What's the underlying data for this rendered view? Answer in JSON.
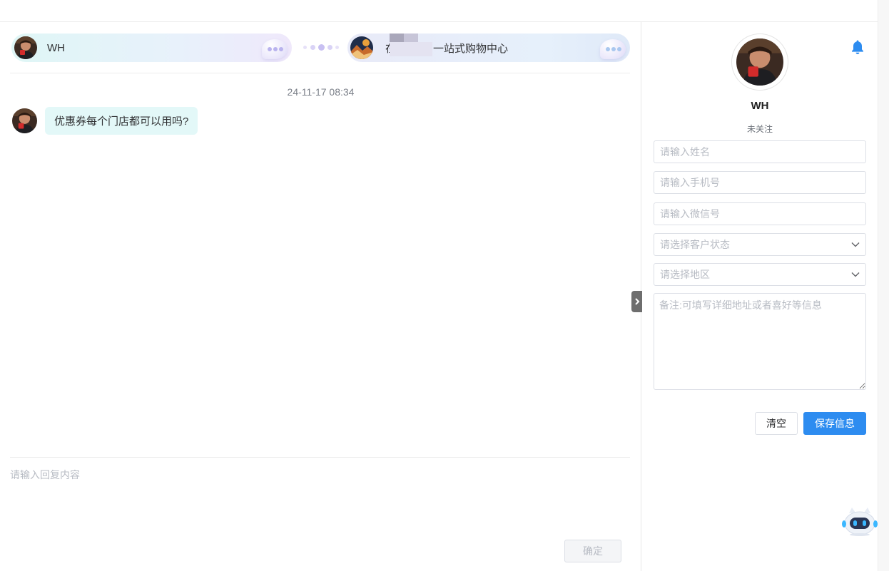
{
  "chat": {
    "user_pill": {
      "name": "WH"
    },
    "shop_pill": {
      "name_visible_start": "在",
      "name_visible_end": "一站式购物中心"
    },
    "timestamp": "24-11-17 08:34",
    "messages": [
      {
        "from": "customer",
        "text": "优惠券每个门店都可以用吗?"
      }
    ],
    "compose": {
      "placeholder": "请输入回复内容",
      "confirm_label": "确定"
    }
  },
  "panel": {
    "customer_name": "WH",
    "follow_status": "未关注",
    "fields": {
      "name_placeholder": "请输入姓名",
      "phone_placeholder": "请输入手机号",
      "wechat_placeholder": "请输入微信号",
      "status_placeholder": "请选择客户状态",
      "region_placeholder": "请选择地区",
      "remark_placeholder": "备注:可填写详细地址或者喜好等信息"
    },
    "clear_label": "清空",
    "save_label": "保存信息"
  },
  "icons": {
    "bell": "bell-icon",
    "collapse": "chevron-right-icon",
    "assistant": "robot-icon",
    "dropdown": "chevron-down-icon"
  },
  "colors": {
    "primary": "#2d8cf0",
    "bubble": "#e3f8f8",
    "border": "#dcdfe6",
    "placeholder": "#b8bcc4"
  }
}
